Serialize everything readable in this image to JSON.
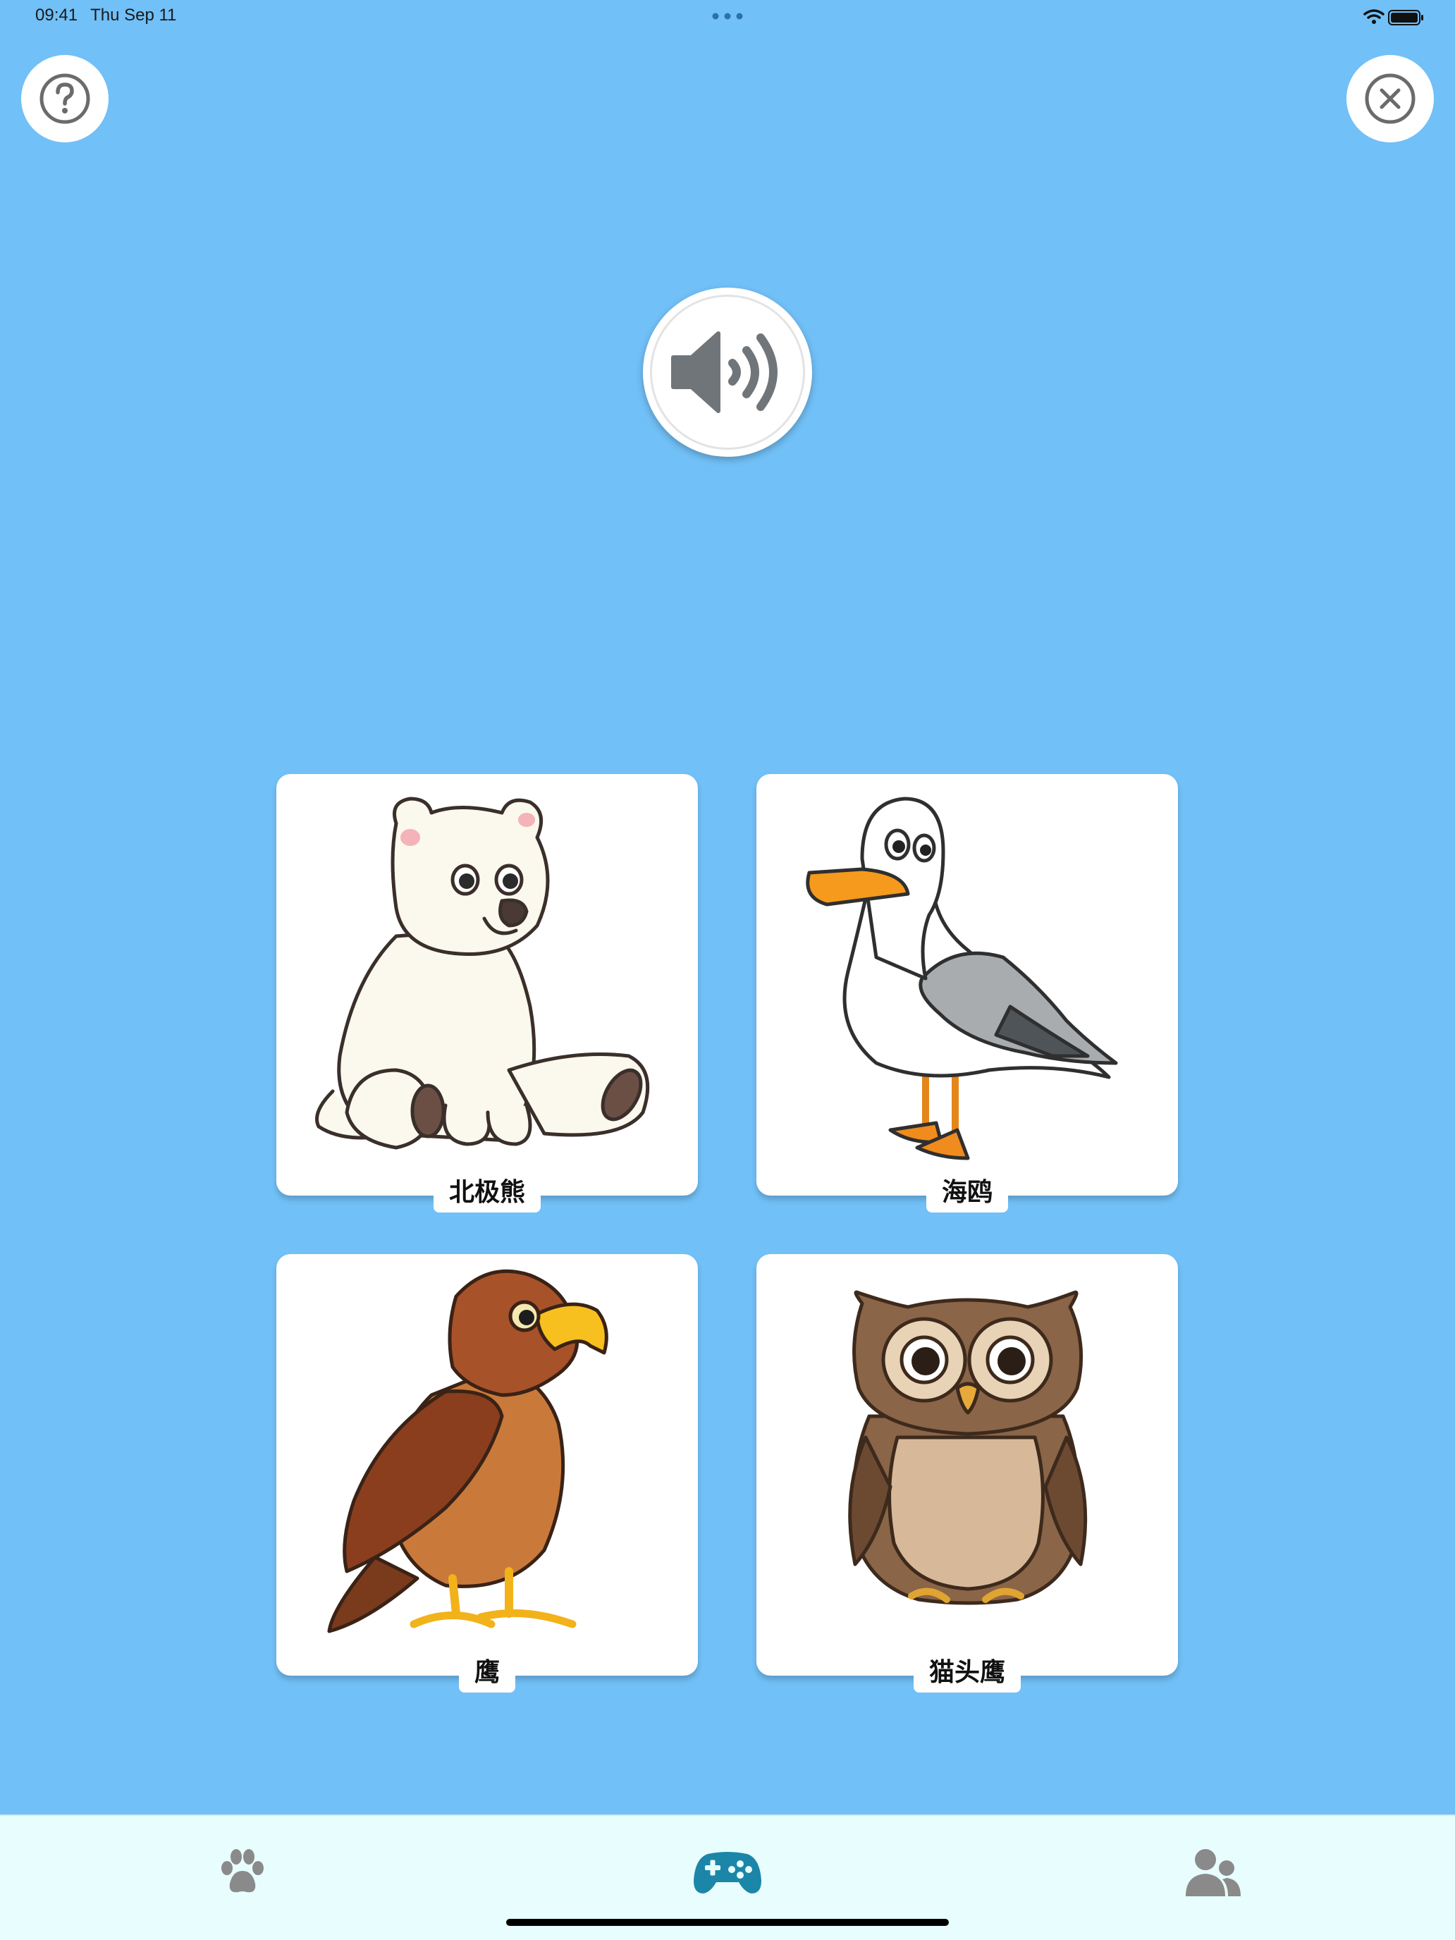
{
  "status_bar": {
    "time": "09:41",
    "date": "Thu Sep 11"
  },
  "top_controls": {
    "help_icon": "question-circle-icon",
    "close_icon": "close-circle-icon"
  },
  "audio": {
    "icon": "speaker-icon"
  },
  "cards": [
    {
      "label": "北极熊",
      "image": "polar-bear"
    },
    {
      "label": "海鸥",
      "image": "seagull"
    },
    {
      "label": "鹰",
      "image": "eagle"
    },
    {
      "label": "猫头鹰",
      "image": "owl"
    }
  ],
  "tab_bar": {
    "tabs": [
      {
        "icon": "paw-icon",
        "selected": false
      },
      {
        "icon": "gamepad-icon",
        "selected": true
      },
      {
        "icon": "users-icon",
        "selected": false
      }
    ]
  },
  "colors": {
    "background": "#71C0F7",
    "tab_bar": "#E8FDFD",
    "selected_tab": "#1B86A8",
    "unselected_tab": "#8A8A8A"
  }
}
